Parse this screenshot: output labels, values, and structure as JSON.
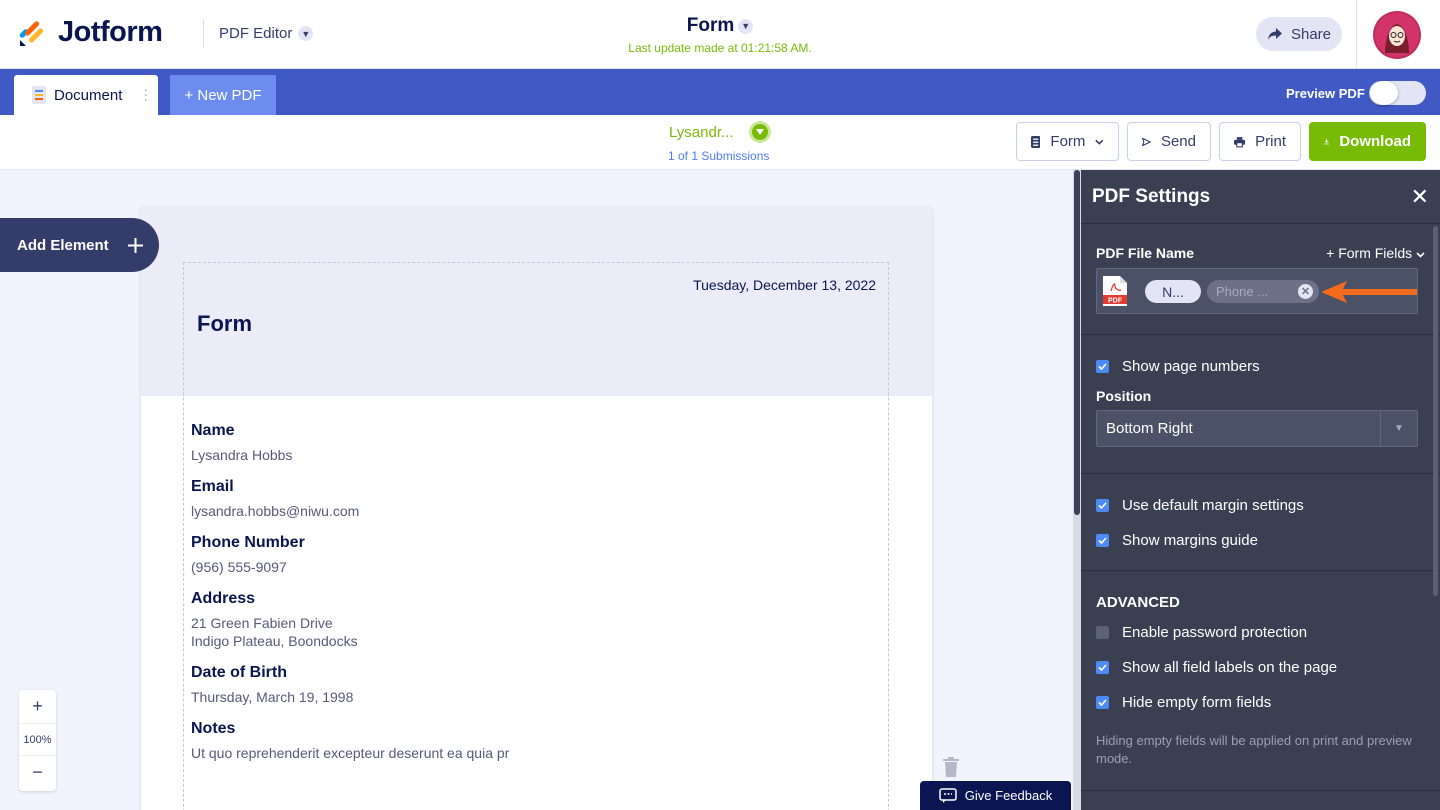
{
  "brand": {
    "name": "Jotform",
    "product": "PDF Editor"
  },
  "header": {
    "form_title": "Form",
    "last_update": "Last update made at 01:21:58 AM.",
    "share_label": "Share"
  },
  "tabs": {
    "document_label": "Document",
    "new_pdf_label": "+ New PDF",
    "preview_label": "Preview PDF"
  },
  "submission": {
    "name": "Lysandr...",
    "count": "1 of 1 Submissions"
  },
  "toolbar": {
    "form_label": "Form",
    "send_label": "Send",
    "print_label": "Print",
    "download_label": "Download"
  },
  "canvas": {
    "add_element_label": "Add Element",
    "date": "Tuesday, December 13, 2022",
    "title": "Form",
    "fields": [
      {
        "label": "Name",
        "value": "Lysandra Hobbs"
      },
      {
        "label": "Email",
        "value": "lysandra.hobbs@niwu.com"
      },
      {
        "label": "Phone Number",
        "value": "(956) 555-9097"
      },
      {
        "label": "Address",
        "value": "21 Green Fabien Drive",
        "value2": "Indigo Plateau, Boondocks"
      },
      {
        "label": "Date of Birth",
        "value": "Thursday, March 19, 1998"
      },
      {
        "label": "Notes",
        "value": "Ut quo reprehenderit excepteur deserunt ea quia pr"
      }
    ],
    "zoom_level": "100%",
    "feedback_label": "Give Feedback"
  },
  "panel": {
    "title": "PDF Settings",
    "file_name_label": "PDF File Name",
    "form_fields_label": "+ Form Fields",
    "chip_1": "N...",
    "chip_2": "Phone ...",
    "show_page_numbers": "Show page numbers",
    "position_label": "Position",
    "position_value": "Bottom Right",
    "use_default_margins": "Use default margin settings",
    "show_margins_guide": "Show margins guide",
    "advanced_label": "ADVANCED",
    "enable_password": "Enable password protection",
    "show_field_labels": "Show all field labels on the page",
    "hide_empty_fields": "Hide empty form fields",
    "hint": "Hiding empty fields will be applied on print and preview mode."
  },
  "colors": {
    "accent_green": "#78bb07",
    "tab_blue": "#4059c5",
    "panel_bg": "#3a3f52",
    "arrow_orange": "#f26b1d"
  }
}
